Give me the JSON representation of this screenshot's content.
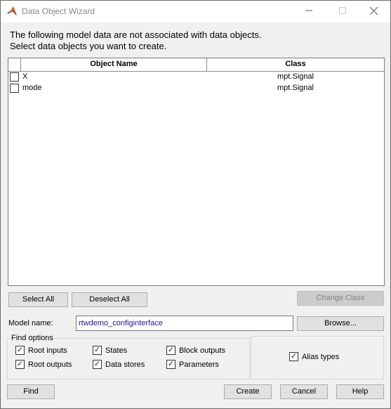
{
  "window": {
    "title": "Data Object Wizard",
    "accent": "#0072bd"
  },
  "intro": {
    "line1": "The following model data are not associated with data objects.",
    "line2": "Select data objects you want to create."
  },
  "table": {
    "columns": [
      "",
      "Object Name",
      "Class"
    ],
    "rows": [
      {
        "checked": false,
        "name": "X",
        "class": "mpt.Signal"
      },
      {
        "checked": false,
        "name": "mode",
        "class": "mpt.Signal"
      }
    ]
  },
  "selection_buttons": {
    "select_all": "Select All",
    "deselect_all": "Deselect All",
    "change_class": "Change Class"
  },
  "model": {
    "label": "Model name:",
    "value": "rtwdemo_configinterface",
    "browse": "Browse..."
  },
  "find_options": {
    "title": "Find options",
    "items": [
      {
        "label": "Root inputs",
        "checked": true
      },
      {
        "label": "States",
        "checked": true
      },
      {
        "label": "Block outputs",
        "checked": true
      },
      {
        "label": "Root outputs",
        "checked": true
      },
      {
        "label": "Data stores",
        "checked": true
      },
      {
        "label": "Parameters",
        "checked": true
      }
    ],
    "alias": {
      "label": "Alias types",
      "checked": true
    }
  },
  "footer": {
    "find": "Find",
    "create": "Create",
    "cancel": "Cancel",
    "help": "Help"
  },
  "icons": {
    "app": "matlab-icon",
    "minimize": "minimize-icon",
    "maximize": "maximize-icon",
    "close": "close-icon",
    "check": "checkmark-icon"
  }
}
